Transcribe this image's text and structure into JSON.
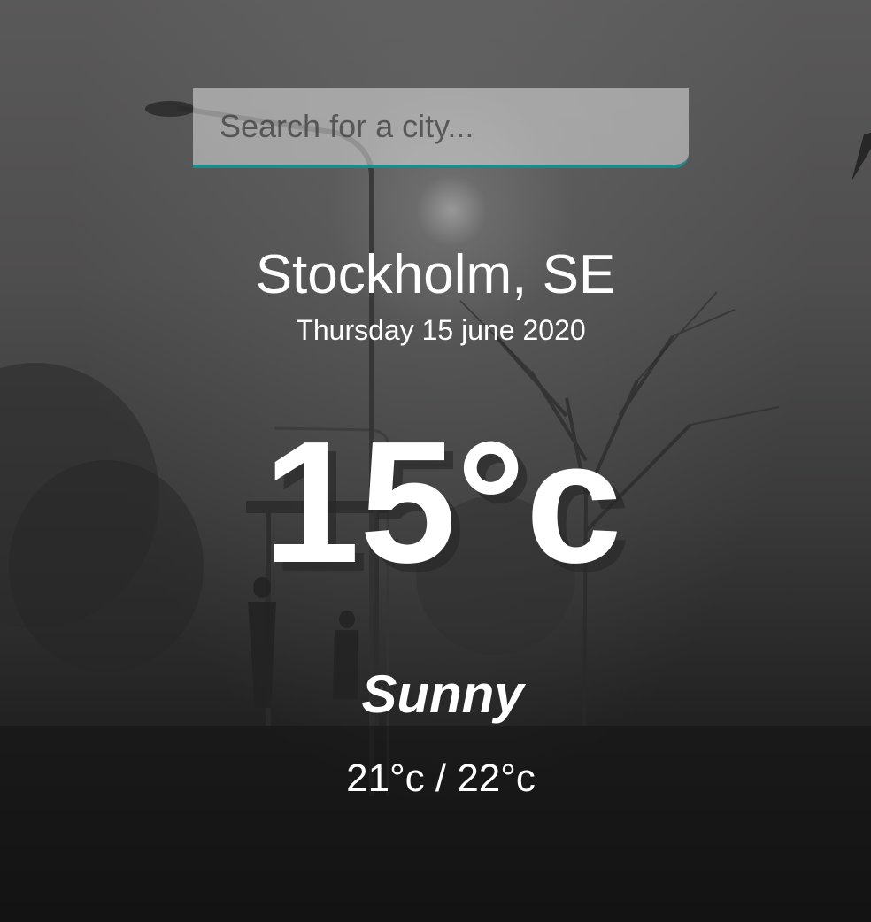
{
  "search": {
    "placeholder": "Search for a city..."
  },
  "weather": {
    "location": "Stockholm, SE",
    "date": "Thursday 15 june 2020",
    "temperature": "15°c",
    "condition": "Sunny",
    "min_max": "21°c / 22°c"
  },
  "colors": {
    "accent": "#1f8a8a",
    "text": "#ffffff"
  }
}
